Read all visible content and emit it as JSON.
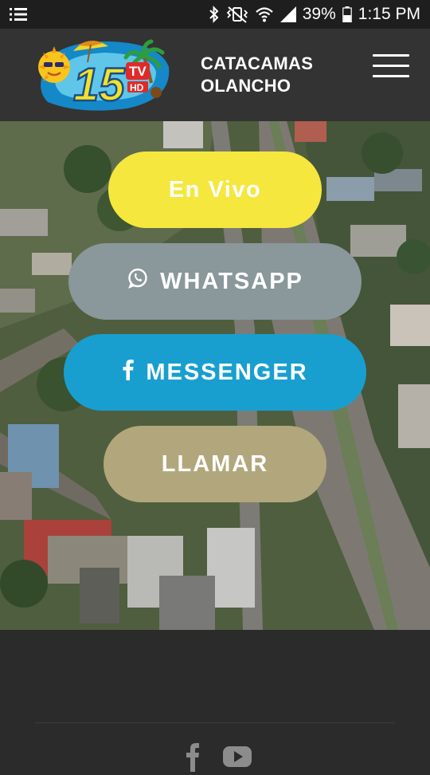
{
  "status_bar": {
    "battery_percent": "39%",
    "time": "1:15 PM",
    "icons": [
      "notification-list-icon",
      "bluetooth-icon",
      "vibrate-icon",
      "wifi-icon",
      "signal-icon",
      "battery-icon"
    ]
  },
  "header": {
    "logo_text": "15",
    "logo_badge": "TV",
    "logo_hd": "HD",
    "title_line1": "CATACAMAS",
    "title_line2": "OLANCHO",
    "menu_icon": "hamburger-menu-icon"
  },
  "buttons": {
    "live": {
      "label": "En Vivo",
      "color": "#f5e73e"
    },
    "whatsapp": {
      "label": "WHATSAPP",
      "icon": "whatsapp-icon",
      "color": "#8a979b"
    },
    "messenger": {
      "label": "MESSENGER",
      "icon": "facebook-icon",
      "color": "#189fcf"
    },
    "call": {
      "label": "LLAMAR",
      "color": "#b2a77c"
    }
  },
  "footer": {
    "social_icons": [
      "facebook-icon",
      "youtube-icon"
    ]
  },
  "colors": {
    "status_bar_bg": "#1e1e1e",
    "header_bg": "#333333",
    "footer_bg": "#2b2b2b"
  }
}
